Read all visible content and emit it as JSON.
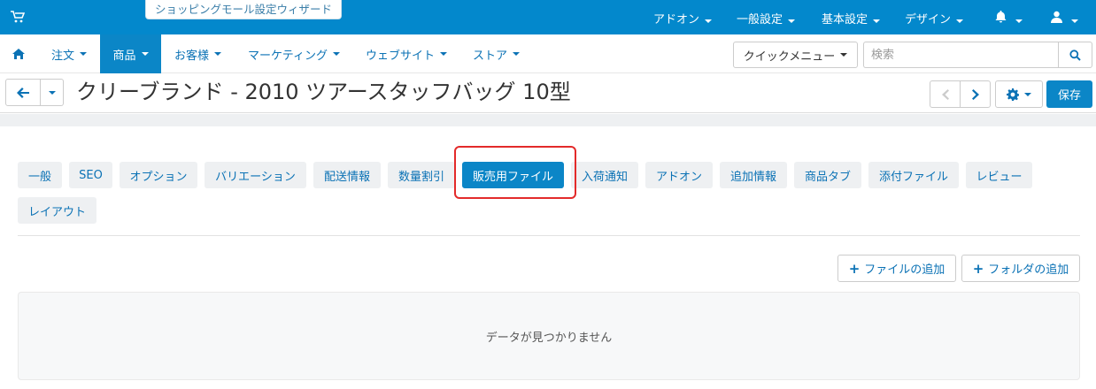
{
  "topbar": {
    "wizard_label": "ショッピングモール設定ウィザード",
    "menu": [
      "アドオン",
      "一般設定",
      "基本設定",
      "デザイン"
    ]
  },
  "nav": {
    "items": [
      "注文",
      "商品",
      "お客様",
      "マーケティング",
      "ウェブサイト",
      "ストア"
    ],
    "active": "商品",
    "quick_menu": "クイックメニュー",
    "search_placeholder": "検索"
  },
  "page": {
    "title": "クリーブランド - 2010 ツアースタッフバッグ 10型",
    "save_label": "保存"
  },
  "tabs": {
    "items": [
      "一般",
      "SEO",
      "オプション",
      "バリエーション",
      "配送情報",
      "数量割引",
      "販売用ファイル",
      "入荷通知",
      "アドオン",
      "追加情報",
      "商品タブ",
      "添付ファイル",
      "レビュー",
      "レイアウト"
    ],
    "active": "販売用ファイル"
  },
  "actions": {
    "add_file": "ファイルの追加",
    "add_folder": "フォルダの追加"
  },
  "empty_message": "データが見つかりません",
  "colors": {
    "topbar": "#0388cc",
    "accent": "#0b86c7",
    "link": "#0b72b5",
    "highlight": "#e32a2a"
  }
}
